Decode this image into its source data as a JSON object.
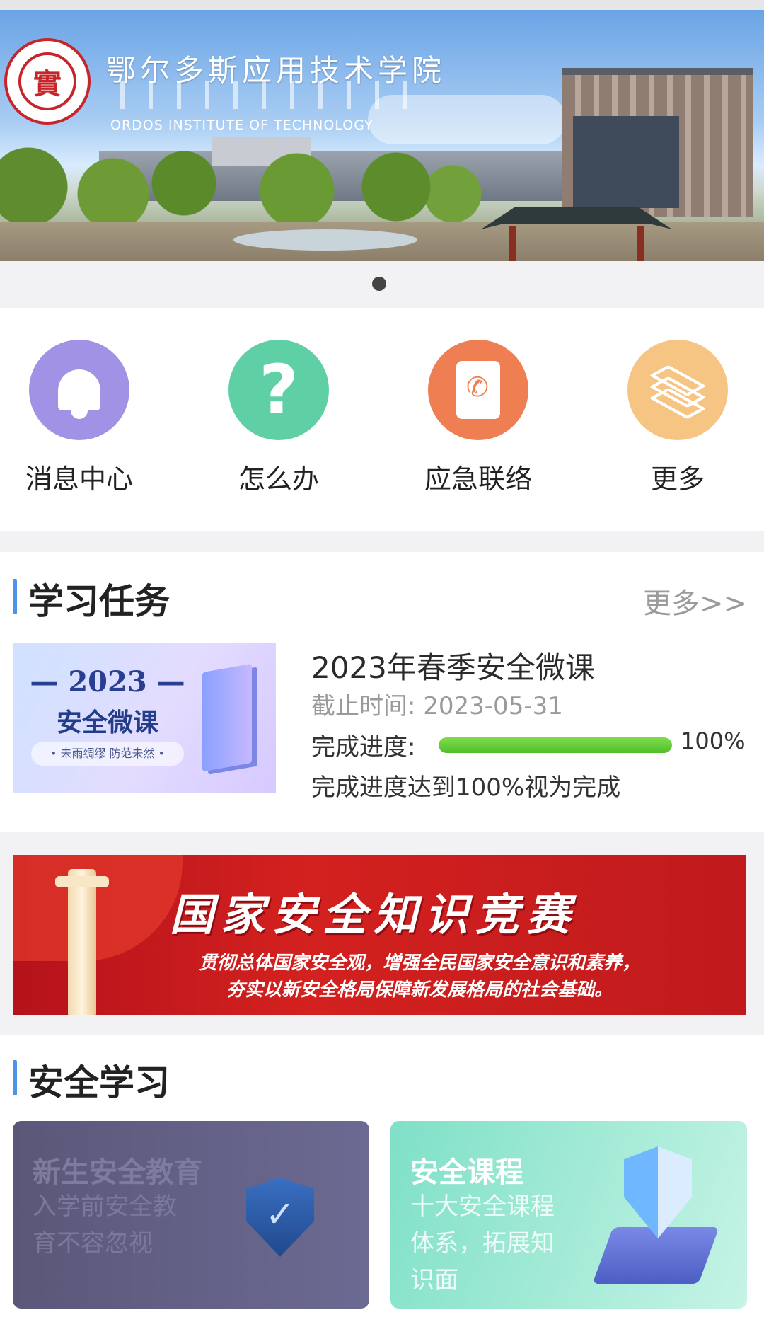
{
  "banner": {
    "school_name_cn": "鄂尔多斯应用技术学院",
    "school_name_en": "ORDOS INSTITUTE OF TECHNOLOGY",
    "seal_char": "實",
    "slides_total": 1,
    "active_slide": 1
  },
  "quick_entries": [
    {
      "label": "消息中心",
      "icon": "bell-icon",
      "color": "#a292e6"
    },
    {
      "label": "怎么办",
      "icon": "question-icon",
      "color": "#5fcfa6"
    },
    {
      "label": "应急联络",
      "icon": "phonebook-icon",
      "color": "#ef7e52"
    },
    {
      "label": "更多",
      "icon": "layers-icon",
      "color": "#f6c583"
    }
  ],
  "study_tasks": {
    "title": "学习任务",
    "more": "更多>>",
    "course": {
      "thumb_year": "— 2023 —",
      "thumb_title": "安全微课",
      "thumb_slogan": "• 未雨绸缪 防范未然 •",
      "name": "2023年春季安全微课",
      "deadline": "截止时间: 2023-05-31",
      "progress_label": "完成进度:",
      "progress_percent": 100,
      "progress_text": "100%",
      "completion_note": "完成进度达到100%视为完成"
    }
  },
  "contest_banner": {
    "title": "国家安全知识竞赛",
    "line1": "贯彻总体国家安全观，增强全民国家安全意识和素养，",
    "line2": "夯实以新安全格局保障新发展格局的社会基础。"
  },
  "safety_learning": {
    "title": "安全学习",
    "cards": [
      {
        "title": "新生安全教育",
        "desc": "入学前安全教育不容忽视",
        "icon": "shield-check-icon"
      },
      {
        "title": "安全课程",
        "desc": "十大安全课程体系，拓展知识面",
        "icon": "shield-chip-icon"
      }
    ]
  }
}
